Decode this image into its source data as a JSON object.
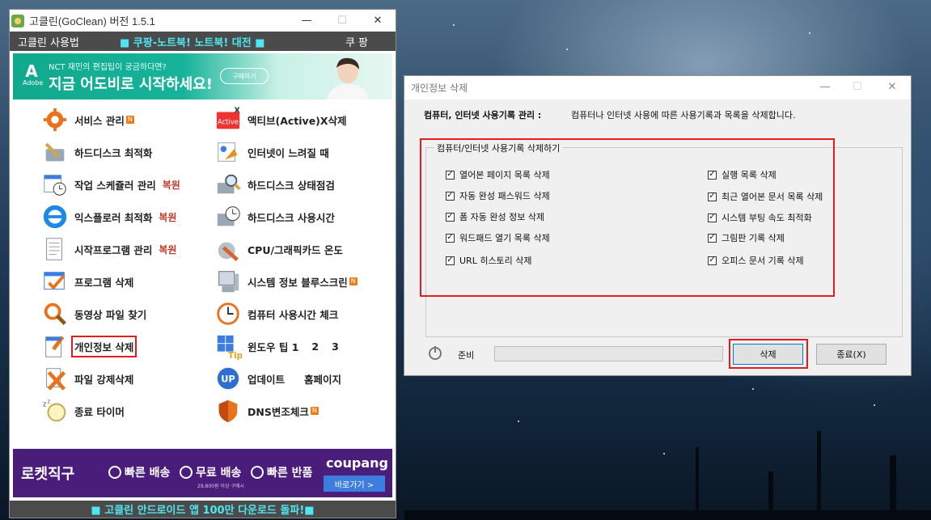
{
  "main_window": {
    "title": "고클린(GoClean) 버전 1.5.1",
    "menu": {
      "left": "고클린 사용법",
      "center": "■ 쿠팡-노트북! 노트북! 대전 ■",
      "right": "쿠 팡"
    },
    "ad_top": {
      "brand": "Adobe",
      "small_text": "NCT 재민의 편집팁이 궁금하다면?",
      "big_text": "지금 어도비로 시작하세요!",
      "button": "구매하기"
    },
    "items": [
      {
        "label": "서비스 관리",
        "icon": "gear-icon",
        "badge": "N"
      },
      {
        "label": "액티브(Active)X삭제",
        "icon": "activex-icon"
      },
      {
        "label": "하드디스크 최적화",
        "icon": "wrench-disk-icon"
      },
      {
        "label": "인터넷이 느려질 때",
        "icon": "internet-speed-icon"
      },
      {
        "label": "작업 스케쥴러 관리",
        "icon": "scheduler-icon",
        "restore": "복원"
      },
      {
        "label": "하드디스크 상태점검",
        "icon": "disk-magnifier-icon"
      },
      {
        "label": "익스플로러 최적화",
        "icon": "ie-icon",
        "restore": "복원"
      },
      {
        "label": "하드디스크 사용시간",
        "icon": "disk-clock-icon"
      },
      {
        "label": "시작프로그램 관리",
        "icon": "startup-document-icon",
        "restore": "복원"
      },
      {
        "label": "CPU/그래픽카드 온도",
        "icon": "temperature-icon"
      },
      {
        "label": "프로그램 삭제",
        "icon": "program-check-icon"
      },
      {
        "label": "시스템 정보 블루스크린",
        "icon": "computer-icon",
        "badge": "N"
      },
      {
        "label": "동영상 파일 찾기",
        "icon": "search-icon"
      },
      {
        "label": "컴퓨터 사용시간 체크",
        "icon": "clock-icon"
      },
      {
        "label": "개인정보 삭제",
        "icon": "privacy-document-icon"
      },
      {
        "label": "윈도우 팁 1",
        "icon": "windows-tip-icon",
        "extra": [
          "2",
          "3"
        ]
      },
      {
        "label": "파일 강제삭제",
        "icon": "file-x-icon"
      },
      {
        "label": "업데이트",
        "icon": "update-icon",
        "extra2": "홈페이지"
      },
      {
        "label": "종료 타이머",
        "icon": "sleep-timer-icon"
      },
      {
        "label": "DNS변조체크",
        "icon": "shield-icon",
        "badge": "N"
      }
    ],
    "ad_bottom": {
      "rocket": "로켓직구",
      "f1": "빠른 배송",
      "f2": "무료 배송",
      "f3": "빠른 반품",
      "sub": "29,800원 이상 구매시",
      "brand": "coupang",
      "go": "바로가기 >"
    },
    "status": "■ 고클린 안드로이드 앱 100만 다운로드 돌파!■"
  },
  "dialog": {
    "title": "개인정보 삭제",
    "header_label": "컴퓨터, 인터넷 사용기록 관리 :",
    "header_desc": "컴퓨터나 인터넷 사용에 따른 사용기록과 목록을 삭제합니다.",
    "group_title": "컴퓨터/인터넷 사용기록 삭제하기",
    "checkboxes_left": [
      {
        "label": "열어본 페이지 목록 삭제",
        "checked": true
      },
      {
        "label": "자동 완성 패스워드 삭제",
        "checked": true
      },
      {
        "label": "폼 자동 완성 정보 삭제",
        "checked": true
      },
      {
        "label": "워드패드 열기 목록 삭제",
        "checked": true
      },
      {
        "label": "URL 히스토리 삭제",
        "checked": true
      }
    ],
    "checkboxes_right": [
      {
        "label": "실행 목록 삭제",
        "checked": true
      },
      {
        "label": "최근 열어본 문서 목록 삭제",
        "checked": true
      },
      {
        "label": "시스템 부팅 속도 최적화",
        "checked": true
      },
      {
        "label": "그림판 기록 삭제",
        "checked": true
      },
      {
        "label": "오피스 문서 기록 삭제",
        "checked": true
      }
    ],
    "status": "준비",
    "progress": 0,
    "delete_button": "삭제",
    "close_button": "종료(X)"
  },
  "window_controls": {
    "minimize": "—",
    "maximize": "☐",
    "close": "✕"
  }
}
